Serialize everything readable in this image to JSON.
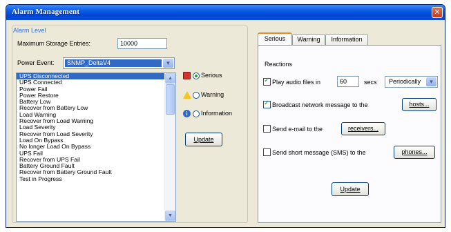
{
  "window": {
    "title": "Alarm Management",
    "close_glyph": "✕"
  },
  "alarm_level": {
    "group_label": "Alarm Level",
    "max_entries_label": "Maximum Storage Entries:",
    "max_entries_value": "10000",
    "power_event_label": "Power Event:",
    "power_event_value": "SNMP_DeltaV4",
    "events": [
      "UPS Disconnected",
      "UPS Connected",
      "Power Fail",
      "Power Restore",
      "Battery Low",
      "Recover from Battery Low",
      "Load Warning",
      "Recover from Load Warning",
      "Load Severity",
      "Recover from Load Severity",
      "Load On Bypass",
      "No longer Load On Bypass",
      "UPS Fail",
      "Recover from UPS Fail",
      "Battery Ground Fault",
      "Recover from Battery Ground Fault",
      "Test in Progress"
    ],
    "selected_index": 0
  },
  "severity": {
    "serious": "Serious",
    "warning": "Warning",
    "information": "Information",
    "selected": "serious",
    "update_label": "Update"
  },
  "tabs": [
    "Serious",
    "Warning",
    "Information"
  ],
  "active_tab": 0,
  "reactions": {
    "label": "Reactions",
    "play_audio_label": "Play audio files in",
    "play_audio_checked": true,
    "interval_value": "60",
    "secs_label": "secs",
    "mode_value": "Periodically",
    "broadcast_label": "Broadcast network message to the",
    "broadcast_checked": true,
    "hosts_button": "hosts...",
    "email_label": "Send e-mail to the",
    "email_checked": false,
    "receivers_button": "receivers...",
    "sms_label": "Send short message (SMS) to the",
    "sms_checked": false,
    "phones_button": "phones...",
    "update_label": "Update"
  }
}
